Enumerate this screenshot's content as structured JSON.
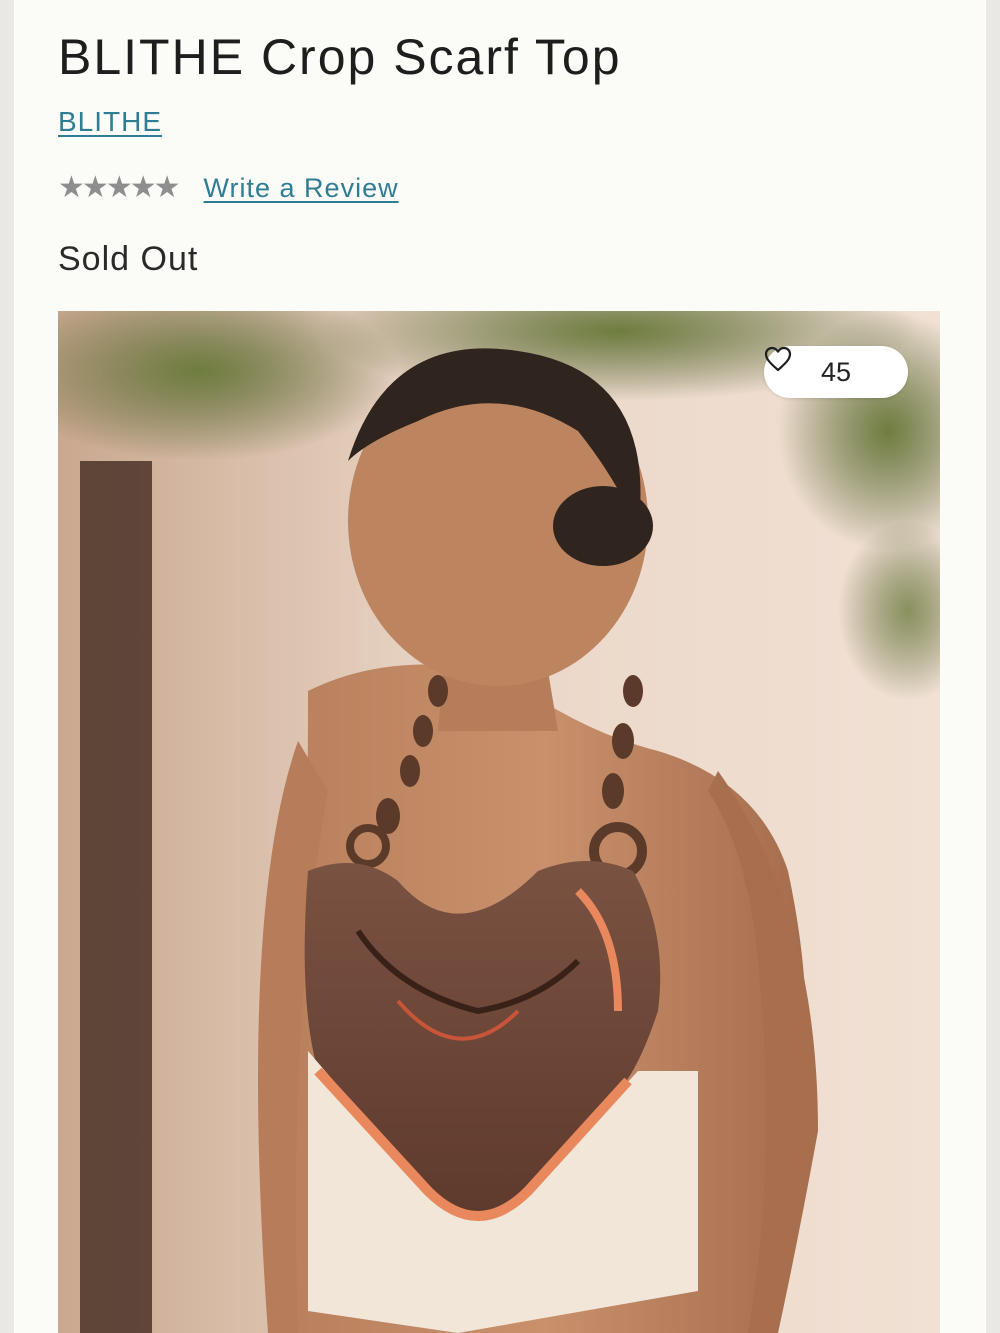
{
  "product": {
    "title": "BLITHE Crop Scarf Top",
    "brand": "BLITHE",
    "rating": {
      "stars_filled": 0,
      "stars_total": 5,
      "star_glyph": "★",
      "star_color": "#8e8e8e",
      "review_link_label": "Write a Review"
    },
    "stock_status": "Sold Out",
    "image": {
      "wishlist_count": "45",
      "wishlist_icon": "heart-outline-icon"
    }
  },
  "colors": {
    "link": "#2f7d92",
    "text": "#1e1e1e",
    "page_background": "#fbfbf8"
  }
}
